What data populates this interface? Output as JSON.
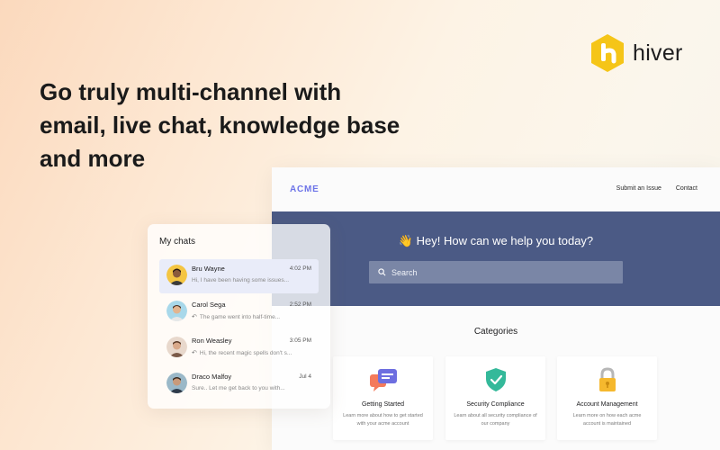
{
  "brand": {
    "name": "hiver",
    "accent": "#f5c518",
    "icon": "hiver-logo-icon"
  },
  "headline": [
    "Go truly multi-channel with",
    "email, live chat, knowledge base",
    "and more"
  ],
  "help_center": {
    "logo": "ACME",
    "nav": {
      "submit": "Submit an Issue",
      "contact": "Contact"
    },
    "hero": {
      "title": "👋 Hey! How can we help you today?",
      "search_placeholder": "Search",
      "background": "#4b5a85"
    },
    "categories_title": "Categories",
    "categories": [
      {
        "icon": "chat-bubbles-icon",
        "title": "Getting Started",
        "desc": "Learn more about how to get started with your acme account"
      },
      {
        "icon": "shield-check-icon",
        "title": "Security Compliance",
        "desc": "Learn about all security compliance of our company"
      },
      {
        "icon": "padlock-icon",
        "title": "Account Management",
        "desc": "Learn more on how each acme account is maintained"
      }
    ]
  },
  "chats": {
    "title": "My chats",
    "items": [
      {
        "name": "Bru Wayne",
        "time": "4:02 PM",
        "preview": "Hi, I have been having some issues...",
        "reply": false,
        "active": true
      },
      {
        "name": "Carol Sega",
        "time": "2:52 PM",
        "preview": "The game went into half-time...",
        "reply": true,
        "active": false
      },
      {
        "name": "Ron Weasley",
        "time": "3:05 PM",
        "preview": "Hi, the recent magic spells don't s...",
        "reply": true,
        "active": false
      },
      {
        "name": "Draco Malfoy",
        "time": "Jul 4",
        "preview": "Sure.. Let me get back to you with...",
        "reply": false,
        "active": false
      }
    ]
  }
}
